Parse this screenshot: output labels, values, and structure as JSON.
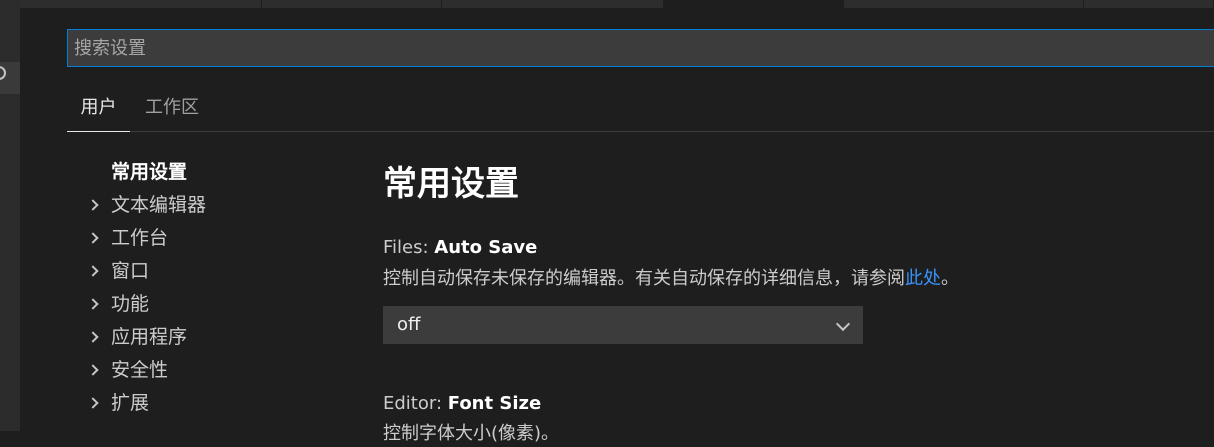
{
  "search": {
    "placeholder": "搜索设置"
  },
  "scope_tabs": [
    {
      "label": "用户",
      "active": true
    },
    {
      "label": "工作区",
      "active": false
    }
  ],
  "toc": [
    {
      "label": "常用设置",
      "selected": true,
      "expandable": false
    },
    {
      "label": "文本编辑器",
      "selected": false,
      "expandable": true
    },
    {
      "label": "工作台",
      "selected": false,
      "expandable": true
    },
    {
      "label": "窗口",
      "selected": false,
      "expandable": true
    },
    {
      "label": "功能",
      "selected": false,
      "expandable": true
    },
    {
      "label": "应用程序",
      "selected": false,
      "expandable": true
    },
    {
      "label": "安全性",
      "selected": false,
      "expandable": true
    },
    {
      "label": "扩展",
      "selected": false,
      "expandable": true
    }
  ],
  "main": {
    "section_title": "常用设置",
    "settings": [
      {
        "category": "Files: ",
        "name": "Auto Save",
        "description": "控制自动保存未保存的编辑器。有关自动保存的详细信息，请参阅",
        "link_text": "此处",
        "description_end": "。",
        "value": "off"
      },
      {
        "category": "Editor: ",
        "name": "Font Size",
        "description": "控制字体大小(像素)。"
      }
    ]
  },
  "colors": {
    "background": "#1e1e1e",
    "input_background": "#3c3c3c",
    "focus_border": "#007fd4",
    "link": "#3794ff"
  }
}
